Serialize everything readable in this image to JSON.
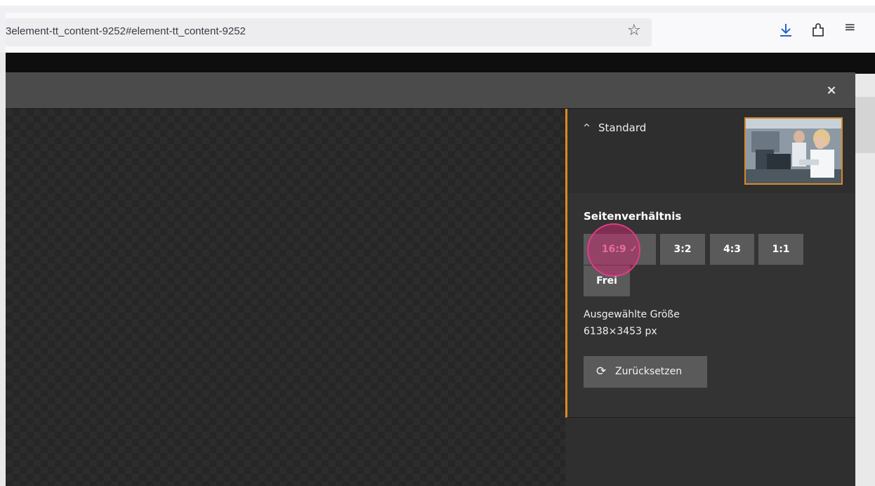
{
  "browser": {
    "url_text": "3element-tt_content-9252#element-tt_content-9252",
    "icons": [
      "bookmark-star-icon",
      "download-icon",
      "extensions-icon",
      "menu-icon"
    ]
  },
  "modal": {
    "close_label": "×",
    "preset": {
      "caret": "^",
      "label": "Standard"
    },
    "aspect_ratio": {
      "title": "Seitenverhältnis",
      "options": [
        {
          "label": "16:9 ✓",
          "selected": true
        },
        {
          "label": "3:2",
          "selected": false
        },
        {
          "label": "4:3",
          "selected": false
        },
        {
          "label": "1:1",
          "selected": false
        },
        {
          "label": "Frei",
          "selected": false
        }
      ]
    },
    "selected_size": {
      "label": "Ausgewählte Größe",
      "value": "6138×3453 px"
    },
    "reset": {
      "icon": "refresh-icon",
      "label": "Zurücksetzen"
    }
  },
  "colors": {
    "accent": "#e08a1e",
    "cursor_highlight": "#dc2878"
  }
}
